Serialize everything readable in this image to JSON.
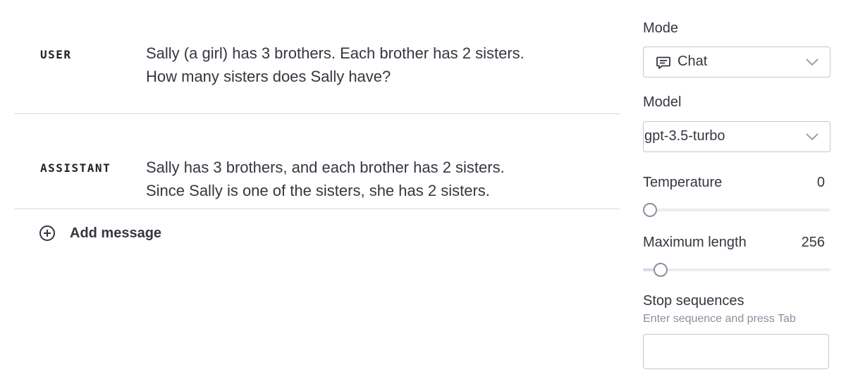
{
  "messages": [
    {
      "role": "USER",
      "lines": [
        "Sally (a girl) has 3 brothers. Each brother has 2 sisters.",
        "How many sisters does Sally have?"
      ]
    },
    {
      "role": "ASSISTANT",
      "lines": [
        "Sally has 3 brothers, and each brother has 2 sisters.",
        "Since Sally is one of the sisters, she has 2 sisters."
      ]
    }
  ],
  "add_message": {
    "label": "Add message",
    "icon": "plus-circle-icon"
  },
  "settings": {
    "mode": {
      "label": "Mode",
      "value": "Chat",
      "icon": "chat-icon"
    },
    "model": {
      "label": "Model",
      "value": "gpt-3.5-turbo"
    },
    "temperature": {
      "label": "Temperature",
      "value": "0",
      "fraction": 0.0
    },
    "max_length": {
      "label": "Maximum length",
      "value": "256",
      "fraction": 0.06
    },
    "stop_sequences": {
      "label": "Stop sequences",
      "hint": "Enter sequence and press Tab",
      "value": ""
    }
  },
  "colors": {
    "text": "#353740",
    "border": "#c5c5d2",
    "divider": "#d9d9e3",
    "muted": "#8e8ea0"
  }
}
